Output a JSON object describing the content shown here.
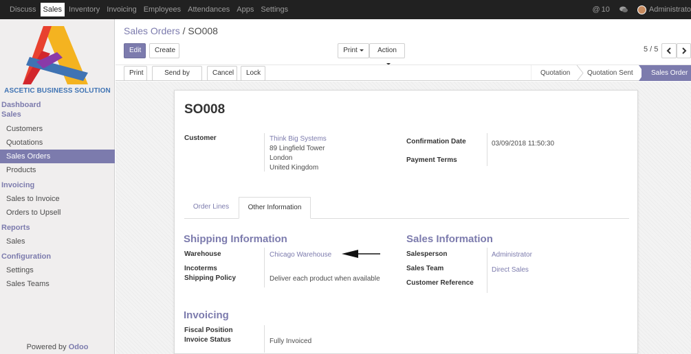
{
  "topbar": {
    "menu": [
      "Discuss",
      "Sales",
      "Inventory",
      "Invoicing",
      "Employees",
      "Attendances",
      "Apps",
      "Settings"
    ],
    "active_index": 1,
    "messages_count": "10",
    "user": "Administrato"
  },
  "sidebar": {
    "company": "ASCETIC BUSINESS SOLUTION",
    "sections": [
      {
        "label": "Dashboard",
        "items": []
      },
      {
        "label": "Sales",
        "items": [
          "Customers",
          "Quotations",
          "Sales Orders",
          "Products"
        ]
      },
      {
        "label": "Invoicing",
        "items": [
          "Sales to Invoice",
          "Orders to Upsell"
        ]
      },
      {
        "label": "Reports",
        "items": [
          "Sales"
        ]
      },
      {
        "label": "Configuration",
        "items": [
          "Settings",
          "Sales Teams"
        ]
      }
    ],
    "active_item": "Sales Orders",
    "powered_prefix": "Powered by ",
    "powered_brand": "Odoo"
  },
  "breadcrumb": {
    "parent": "Sales Orders",
    "separator": " / ",
    "current": "SO008"
  },
  "buttons": {
    "edit": "Edit",
    "create": "Create",
    "print_dd": "Print",
    "action_dd": "Action",
    "print": "Print",
    "send_email": "Send by Email",
    "cancel": "Cancel",
    "lock": "Lock"
  },
  "pager": {
    "text": "5 / 5"
  },
  "statusbar": {
    "stages": [
      "Quotation",
      "Quotation Sent",
      "Sales Order"
    ],
    "current_index": 2
  },
  "record": {
    "name": "SO008",
    "customer_label": "Customer",
    "customer_name": "Think Big Systems",
    "address_lines": [
      "89 Lingfield Tower",
      "London",
      "United Kingdom"
    ],
    "confirmation_date_label": "Confirmation Date",
    "confirmation_date": "03/09/2018 11:50:30",
    "payment_terms_label": "Payment Terms"
  },
  "tabs": [
    {
      "label": "Order Lines",
      "active": false
    },
    {
      "label": "Other Information",
      "active": true
    }
  ],
  "shipping": {
    "heading": "Shipping Information",
    "warehouse_label": "Warehouse",
    "warehouse": "Chicago Warehouse",
    "incoterms_label": "Incoterms",
    "policy_label": "Shipping Policy",
    "policy": "Deliver each product when available"
  },
  "sales_info": {
    "heading": "Sales Information",
    "salesperson_label": "Salesperson",
    "salesperson": "Administrator",
    "team_label": "Sales Team",
    "team": "Direct Sales",
    "customer_ref_label": "Customer Reference"
  },
  "invoicing": {
    "heading": "Invoicing",
    "fiscal_label": "Fiscal Position",
    "status_label": "Invoice Status",
    "status": "Fully Invoiced"
  },
  "colors": {
    "accent": "#7c7bad",
    "navbar": "#212121",
    "logo_blue": "#3f73b3"
  }
}
